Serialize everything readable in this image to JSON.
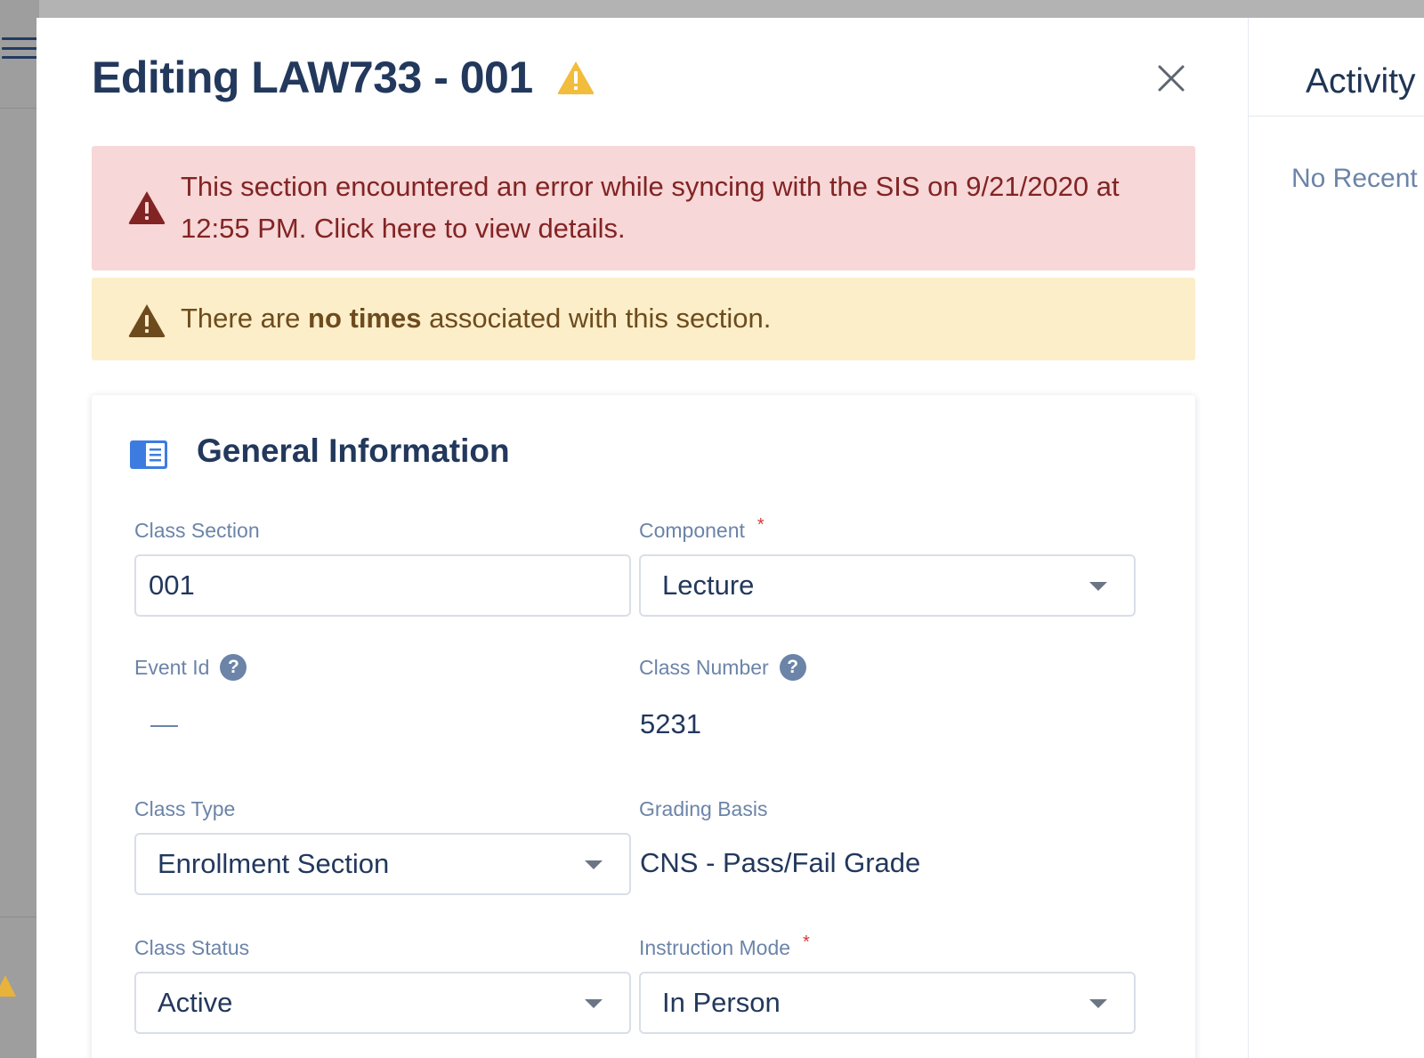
{
  "colors": {
    "primary_text": "#22385c",
    "label": "#6b84a8",
    "error_bg": "#f7d7d7",
    "error_text": "#822424",
    "warning_bg": "#fbeec9",
    "warning_text": "#6e4b1d",
    "warning_icon": "#f2bc3d",
    "accent_blue": "#3c7ce0",
    "required": "#d63939"
  },
  "modal": {
    "title": "Editing LAW733 - 001",
    "title_icon": "warning-icon",
    "close_icon": "close-icon"
  },
  "alerts": {
    "error": {
      "icon": "alert-triangle-icon",
      "text": "This section encountered an error while syncing with the SIS on 9/21/2020 at 12:55 PM. Click here to view details."
    },
    "warning": {
      "icon": "alert-triangle-icon",
      "prefix": "There are ",
      "bold": "no times",
      "suffix": " associated with this section."
    }
  },
  "general_info": {
    "icon": "info-card-icon",
    "title": "General Information",
    "fields": {
      "class_section": {
        "label": "Class Section",
        "value": "001"
      },
      "component": {
        "label": "Component",
        "required_mark": "*",
        "value": "Lecture"
      },
      "event_id": {
        "label": "Event Id",
        "help": "?",
        "value": "—"
      },
      "class_number": {
        "label": "Class Number",
        "help": "?",
        "value": "5231"
      },
      "class_type": {
        "label": "Class Type",
        "value": "Enrollment Section"
      },
      "grading_basis": {
        "label": "Grading Basis",
        "value": "CNS - Pass/Fail Grade"
      },
      "class_status": {
        "label": "Class Status",
        "value": "Active"
      },
      "instruction_mode": {
        "label": "Instruction Mode",
        "required_mark": "*",
        "value": "In Person"
      }
    }
  },
  "activity": {
    "title": "Activity",
    "empty_text": "No Recent"
  },
  "background": {
    "menu_icon": "hamburger-menu-icon"
  }
}
